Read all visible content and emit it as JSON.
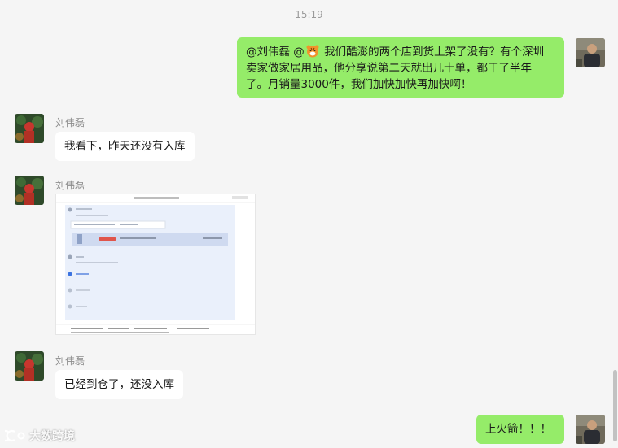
{
  "chat": {
    "timestamp": "15:19",
    "messages": [
      {
        "sender": "me",
        "mention_1": "@刘伟磊",
        "mention_2": "@",
        "emoji_icon": "tiger-emoji",
        "text_line1": "我们酷澎的两个店到货上架了没有？有个深圳",
        "text_line2": "卖家做家居用品，他分享说第二天就出几十单，都干了半年",
        "text_line3": "了。月销量3000件，我们加快加快再加快啊！"
      },
      {
        "sender": "other",
        "name": "刘伟磊",
        "text": "我看下，昨天还没有入库"
      },
      {
        "sender": "other",
        "name": "刘伟磊",
        "type": "image"
      },
      {
        "sender": "other",
        "name": "刘伟磊",
        "text": "已经到仓了，还没入库"
      },
      {
        "sender": "me",
        "text": "上火箭！！！"
      }
    ]
  },
  "watermark": {
    "text": "大数跨境"
  }
}
